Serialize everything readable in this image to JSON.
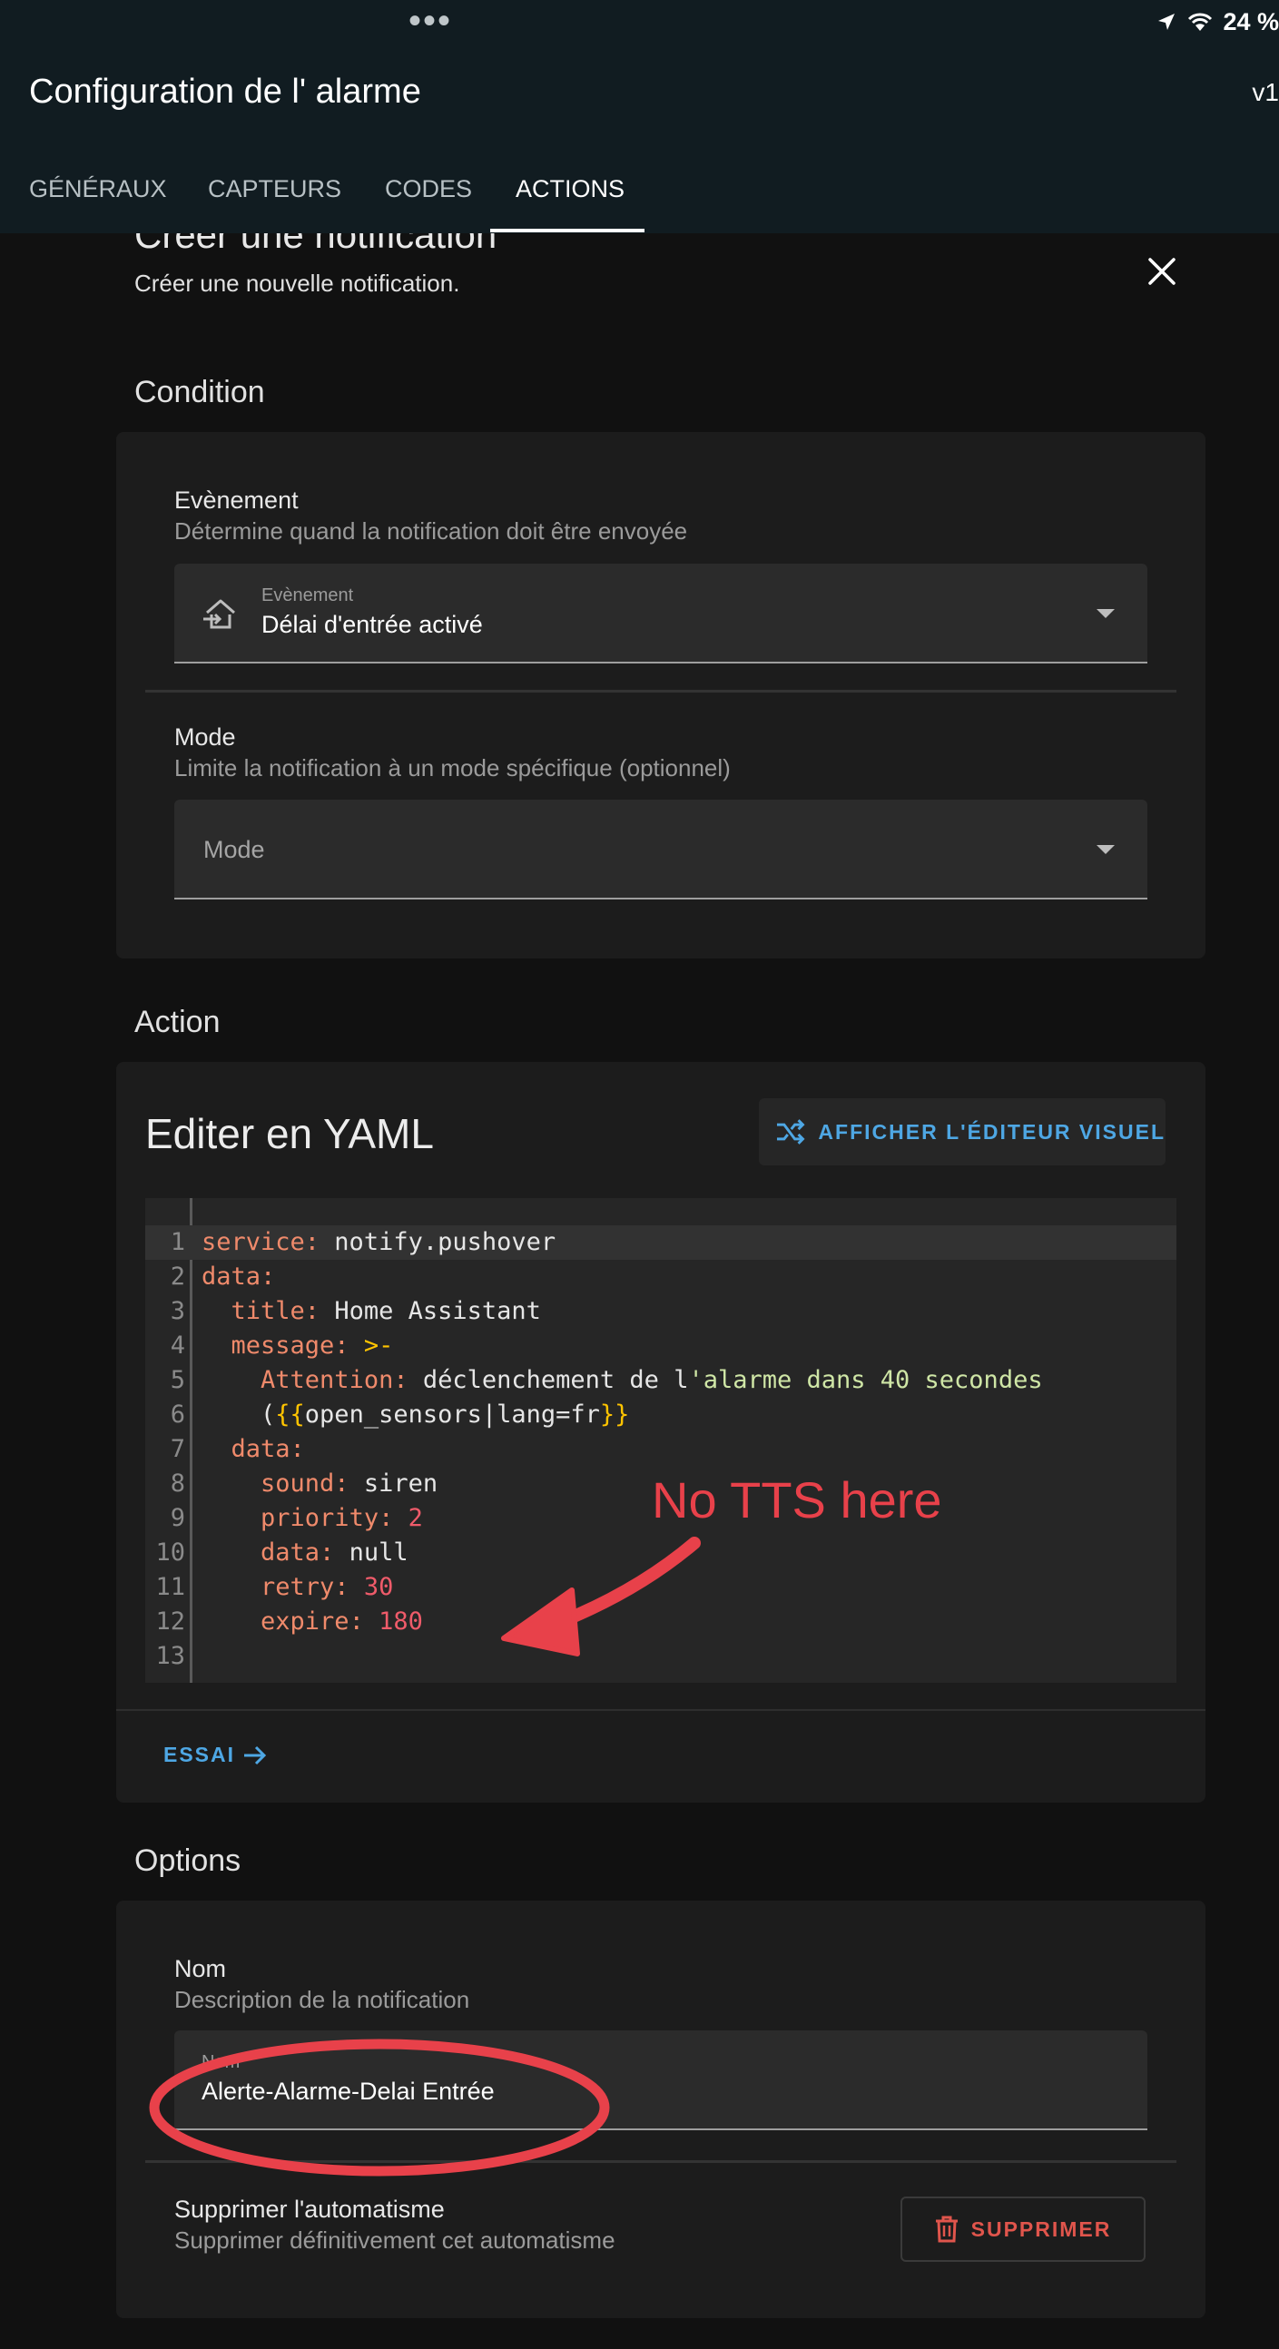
{
  "status_bar": {
    "dots": "•••",
    "battery": "24 %"
  },
  "header": {
    "title": "Configuration de l' alarme",
    "version": "v1"
  },
  "tabs": [
    {
      "label": "GÉNÉRAUX"
    },
    {
      "label": "CAPTEURS"
    },
    {
      "label": "CODES"
    },
    {
      "label": "ACTIONS",
      "active": true
    }
  ],
  "dialog": {
    "title": "Créer une notification",
    "subtitle": "Créer une nouvelle notification."
  },
  "condition": {
    "section_title": "Condition",
    "event": {
      "title": "Evènement",
      "description": "Détermine quand la notification doit être envoyée",
      "label": "Evènement",
      "value": "Délai d'entrée activé"
    },
    "mode": {
      "title": "Mode",
      "description": "Limite la notification à un mode spécifique (optionnel)",
      "placeholder": "Mode"
    }
  },
  "action": {
    "section_title": "Action",
    "editor_title": "Editer en YAML",
    "visual_button": "AFFICHER L'ÉDITEUR VISUEL",
    "test_button": "ESSAI",
    "yaml_lines": [
      "service: notify.pushover",
      "data:",
      "  title: Home Assistant",
      "  message: >-",
      "    Attention: déclenchement de l'alarme dans 40 secondes",
      "    ({{open_sensors|lang=fr}}",
      "  data:",
      "    sound: siren",
      "    priority: 2",
      "    data: null",
      "    retry: 30",
      "    expire: 180",
      ""
    ]
  },
  "annotation": {
    "text": "No TTS here",
    "color": "#e8414a"
  },
  "options": {
    "section_title": "Options",
    "name": {
      "title": "Nom",
      "description": "Description de la notification",
      "label": "Nom",
      "value": "Alerte-Alarme-Delai Entrée"
    },
    "delete": {
      "title": "Supprimer l'automatisme",
      "description": "Supprimer définitivement cet automatisme",
      "button": "SUPPRIMER"
    }
  },
  "colors": {
    "accent": "#4ea7e4",
    "danger": "#e0554c",
    "header_bg": "#111c21"
  }
}
